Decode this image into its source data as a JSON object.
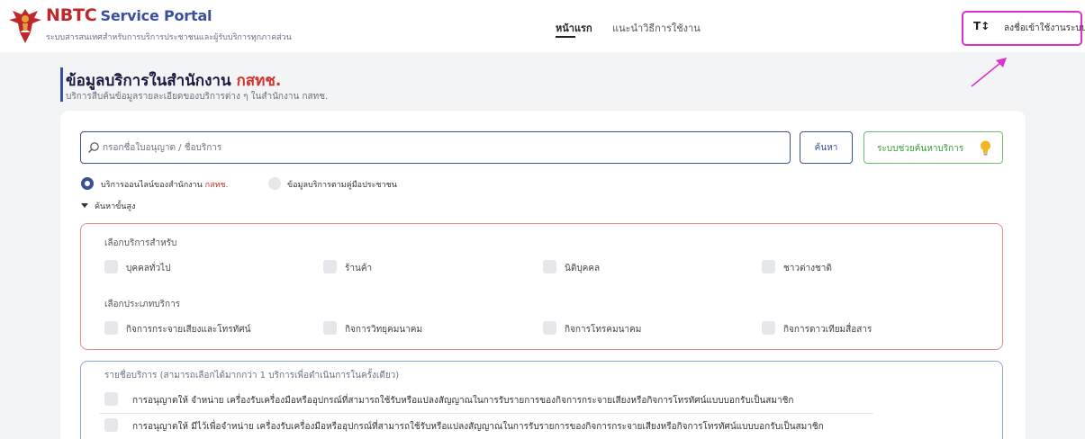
{
  "header": {
    "brand": "NBTC",
    "service": "Service Portal",
    "subtitle": "ระบบสารสนเทศสำหรับการบริการประชาชนและผู้รับบริการทุกภาคส่วน",
    "nav": [
      {
        "label": "หน้าแรก",
        "active": true
      },
      {
        "label": "แนะนำวิธีการใช้งาน",
        "active": false
      }
    ],
    "font_size_icon": "text-size-icon",
    "font_size_glyph": "T↕",
    "login_label": "ลงชื่อเข้าใช้งานระบบ",
    "highlight_color": "#e030c8"
  },
  "page": {
    "title": "ข้อมูลบริการในสำนักงาน",
    "title_org": "กสทช.",
    "subtitle": "บริการสืบค้นข้อมูลรายละเอียดของบริการต่าง ๆ ในสำนักงาน กสทช."
  },
  "search": {
    "placeholder": "กรอกชื่อใบอนุญาต / ชื่อบริการ",
    "value": "",
    "button_label": "ค้นหา",
    "assist_label": "ระบบช่วยค้นหาบริการ"
  },
  "source_options": [
    {
      "label": "บริการออนไลน์ของสำนักงาน",
      "org": "กสทช.",
      "selected": true
    },
    {
      "label": "ข้อมูลบริการตามคู่มือประชาชน",
      "org": "",
      "selected": false
    }
  ],
  "advanced": {
    "label": "ค้นหาขั้นสูง",
    "expanded": true,
    "target_group": {
      "title": "เลือกบริการสำหรับ",
      "options": [
        "บุคคลทั่วไป",
        "ร้านค้า",
        "นิติบุคคล",
        "ชาวต่างชาติ"
      ]
    },
    "type_group": {
      "title": "เลือกประเภทบริการ",
      "options": [
        "กิจการกระจายเสียงและโทรทัศน์",
        "กิจการวิทยุคมนาคม",
        "กิจการโทรคมนาคม",
        "กิจการดาวเทียมสื่อสาร"
      ]
    }
  },
  "service_list": {
    "title": "รายชื่อบริการ (สามารถเลือกได้มากกว่า 1 บริการเพื่อดำเนินการในครั้งเดียว)",
    "items": [
      "การอนุญาตให้ จำหน่าย เครื่องรับเครื่องมือหรืออุปกรณ์ที่สามารถใช้รับหรือแปลงสัญญาณในการรับรายการของกิจการกระจายเสียงหรือกิจการโทรทัศน์แบบบอกรับเป็นสมาชิก",
      "การอนุญาตให้ มีไว้เพื่อจำหน่าย เครื่องรับเครื่องมือหรืออุปกรณ์ที่สามารถใช้รับหรือแปลงสัญญาณในการรับรายการของกิจการกระจายเสียงหรือกิจการโทรทัศน์แบบบอกรับเป็นสมาชิก"
    ]
  },
  "colors": {
    "primary": "#3b4fa0",
    "accent_red": "#d0322f",
    "assist_green": "#3aa03a",
    "filter_border": "#e58b85",
    "list_border": "#8fa3da"
  }
}
